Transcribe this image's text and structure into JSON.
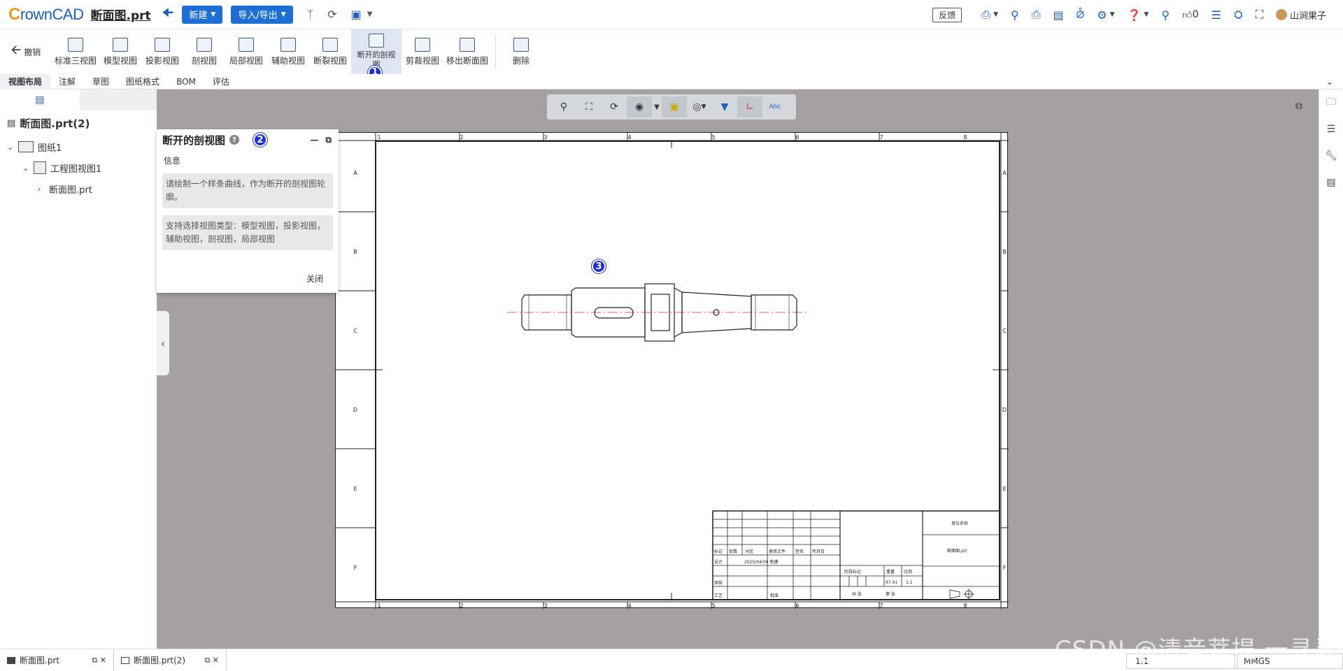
{
  "app": {
    "logo": "rownCAD",
    "logo_c": "C",
    "doc_title": "断面图.prt"
  },
  "topbar": {
    "new_label": "新建",
    "import_export_label": "导入/导出",
    "feedback_label": "反馈",
    "likes_count": "0",
    "user_name": "山涧果子"
  },
  "ribbon": {
    "undo_label": "撤销",
    "tools": [
      {
        "label": "标准三视图"
      },
      {
        "label": "模型视图"
      },
      {
        "label": "投影视图"
      },
      {
        "label": "剖视图"
      },
      {
        "label": "局部视图"
      },
      {
        "label": "辅助视图"
      },
      {
        "label": "断裂视图"
      },
      {
        "label": "断开的剖视图"
      },
      {
        "label": "剪裁视图"
      },
      {
        "label": "移出断面图"
      },
      {
        "label": "删除"
      }
    ]
  },
  "tabs": [
    "视图布局",
    "注解",
    "草图",
    "图纸格式",
    "BOM",
    "评估"
  ],
  "tree": {
    "root": "断面图.prt(2)",
    "items": [
      {
        "label": "图纸1"
      },
      {
        "label": "工程图视图1"
      },
      {
        "label": "断面图.prt"
      }
    ]
  },
  "dialog": {
    "title": "断开的剖视图",
    "section": "信息",
    "msg1": "请绘制一个样条曲线，作为断开的剖视图轮廓。",
    "msg2": "支持选择视图类型：模型视图，投影视图，辅助视图，剖视图，局部视图",
    "close_label": "关闭"
  },
  "badges": [
    "1",
    "2",
    "3"
  ],
  "sheet": {
    "col_labels": [
      "1",
      "2",
      "3",
      "4",
      "5",
      "6",
      "7",
      "8"
    ],
    "row_labels": [
      "A",
      "B",
      "C",
      "D",
      "E",
      "F"
    ],
    "title_block": {
      "company": "单位名称",
      "part_name": "断面图.prt",
      "date": "2025/04/09 新建",
      "weight": "97.41",
      "scale": "1:1",
      "header_cells": [
        "标记",
        "处数",
        "分区",
        "更改文件",
        "签名",
        "年月日"
      ],
      "left_rows": [
        "设计",
        "审核",
        "工艺"
      ],
      "approve": "批准",
      "stage_labels": [
        "阶段标记",
        "重量",
        "比例"
      ],
      "sheets": "共 张",
      "sheet_of": "第 张"
    }
  },
  "bottombar": {
    "tabs": [
      {
        "label": "断面图.prt"
      },
      {
        "label": "断面图.prt(2)"
      }
    ],
    "scale": "1:1",
    "units": "MMGS"
  },
  "watermark": "CSDN @清音菩提 一寻寻",
  "colors": {
    "accent": "#1d6fd6",
    "canvas_bg": "#a5a0a1",
    "badge": "#1f2fd6",
    "center_line": "#e03030"
  }
}
